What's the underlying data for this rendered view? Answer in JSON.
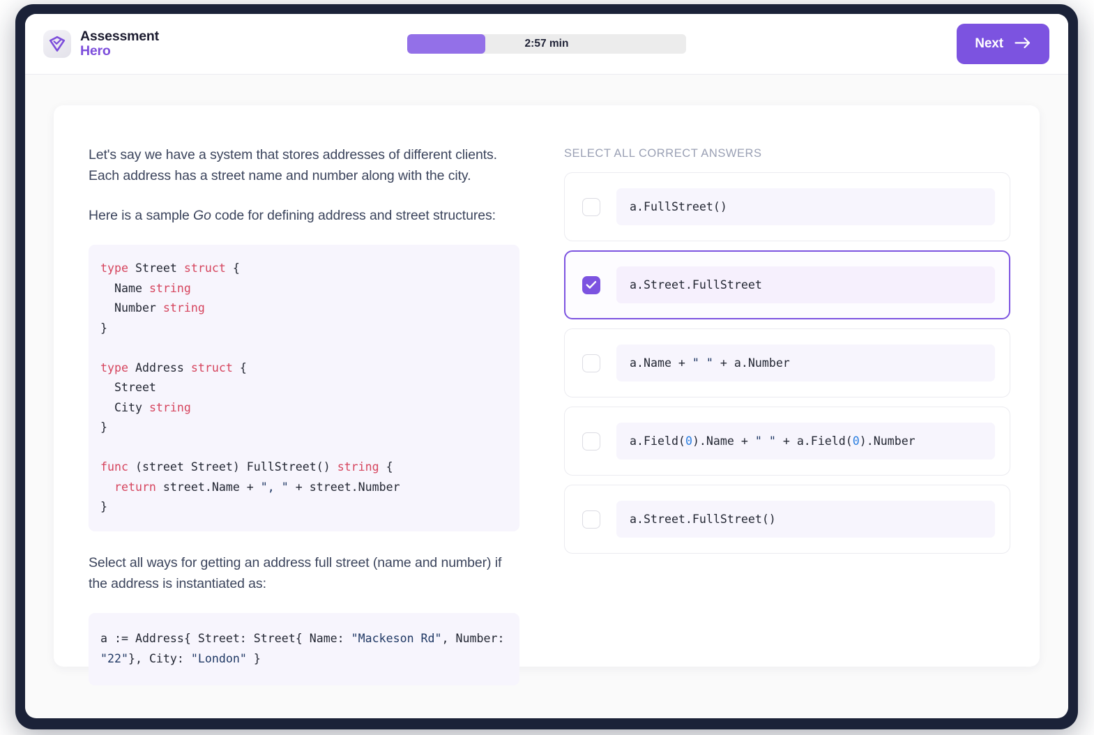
{
  "header": {
    "brand_line1": "Assessment",
    "brand_line2": "Hero",
    "logo_icon": "shield-check-icon",
    "timer_label": "2:57 min",
    "timer_progress_percent": 28,
    "next_label": "Next",
    "next_icon": "arrow-right-icon"
  },
  "question": {
    "paragraph_1": "Let's say we have a system that stores addresses of different clients. Each address has a street name and number along with the city.",
    "paragraph_2_before": "Here is a sample ",
    "paragraph_2_em": "Go",
    "paragraph_2_after": " code for defining address and street structures:",
    "code_sample": "type Street struct {\n  Name string\n  Number string\n}\n\ntype Address struct {\n  Street\n  City string\n}\n\nfunc (street Street) FullStreet() string {\n  return street.Name + \", \" + street.Number\n}",
    "paragraph_3": "Select all ways for getting an address full street (name and number) if the address is instantiated as:",
    "code_instance": "a := Address{ Street: Street{ Name: \"Mackeson Rd\", Number: \"22\"}, City: \"London\" }"
  },
  "answers": {
    "heading": "SELECT ALL CORRECT ANSWERS",
    "options": [
      {
        "text": "a.FullStreet()",
        "selected": false
      },
      {
        "text": "a.Street.FullStreet",
        "selected": true
      },
      {
        "text": "a.Name + \" \" + a.Number",
        "selected": false
      },
      {
        "text": "a.Field(0).Name + \" \" + a.Field(0).Number",
        "selected": false
      },
      {
        "text": "a.Street.FullStreet()",
        "selected": false
      }
    ]
  },
  "colors": {
    "accent_purple": "#7c53e0",
    "accent_purple_light": "#9370e8",
    "frame_dark": "#1b2238",
    "code_bg": "#f7f5fd",
    "keyword_red": "#d6455e",
    "string_navy": "#1f3864",
    "number_blue": "#2b7fe0"
  }
}
